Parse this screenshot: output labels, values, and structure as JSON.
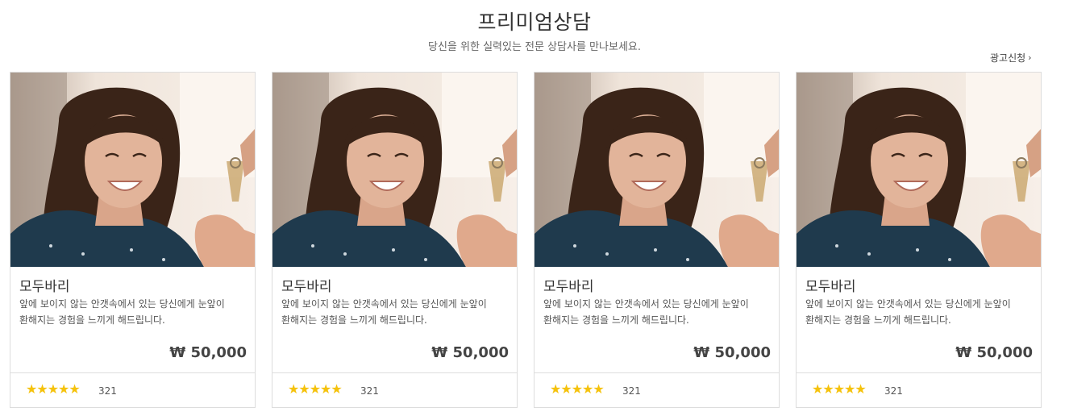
{
  "header": {
    "title": "프리미엄상담",
    "subtitle": "당신을 위한 실력있는 전문 상담사를 만나보세요.",
    "ad_link": "광고신청",
    "ad_chevron": "›"
  },
  "colors": {
    "star": "#f5c20c",
    "border": "#dddddd",
    "text": "#333333"
  },
  "cards": [
    {
      "name": "모두바리",
      "description": "앞에 보이지 않는 안갯속에서 있는 당신에게 눈앞이 환해지는 경험을 느끼게 해드립니다.",
      "price": "₩ 50,000",
      "stars": "★★★★★",
      "rating_count": "321"
    },
    {
      "name": "모두바리",
      "description": "앞에 보이지 않는 안갯속에서 있는 당신에게 눈앞이 환해지는 경험을 느끼게 해드립니다.",
      "price": "₩ 50,000",
      "stars": "★★★★★",
      "rating_count": "321"
    },
    {
      "name": "모두바리",
      "description": "앞에 보이지 않는 안갯속에서 있는 당신에게 눈앞이 환해지는 경험을 느끼게 해드립니다.",
      "price": "₩ 50,000",
      "stars": "★★★★★",
      "rating_count": "321"
    },
    {
      "name": "모두바리",
      "description": "앞에 보이지 않는 안갯속에서 있는 당신에게 눈앞이 환해지는 경험을 느끼게 해드립니다.",
      "price": "₩ 50,000",
      "stars": "★★★★★",
      "rating_count": "321"
    }
  ]
}
